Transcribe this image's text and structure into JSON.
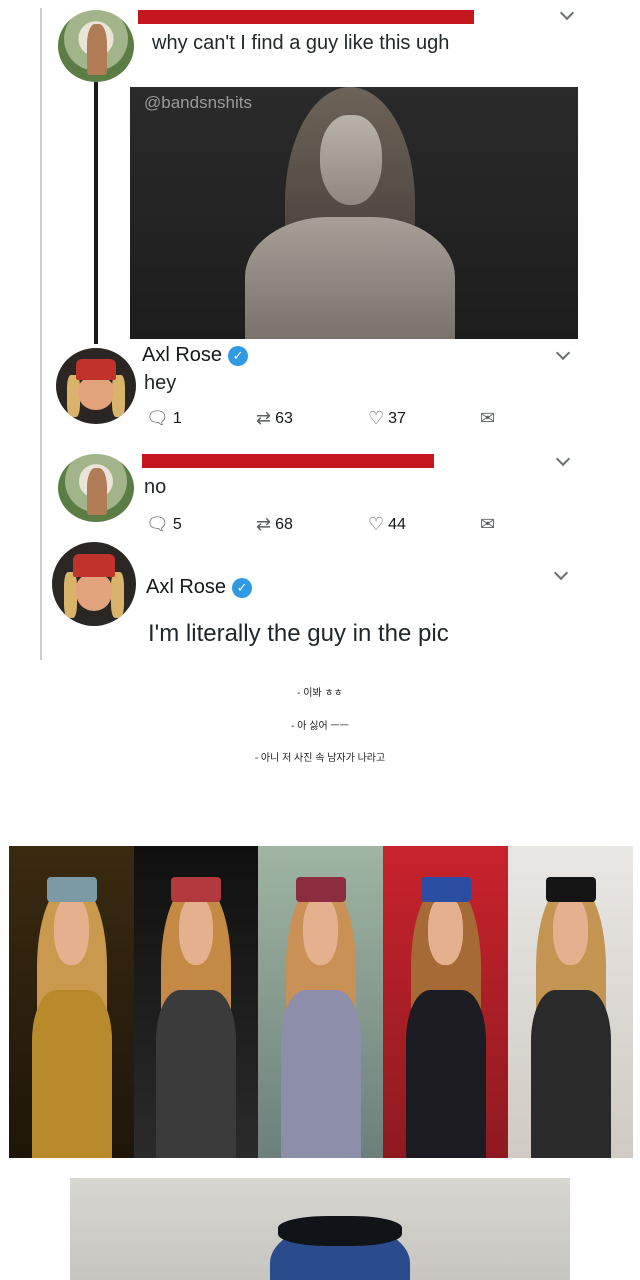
{
  "tweets": {
    "first": {
      "text": "why can't I find a guy like this ugh",
      "image_watermark": "@bandsnshits"
    },
    "reply1": {
      "name": "Axl Rose",
      "text": "hey",
      "replies": "1",
      "retweets": "63",
      "likes": "37"
    },
    "reply2": {
      "text": "no",
      "replies": "5",
      "retweets": "68",
      "likes": "44"
    },
    "reply3": {
      "name": "Axl Rose",
      "text": "I'm literally the guy in the pic"
    }
  },
  "captions": [
    "- 이봐 ㅎㅎ",
    "- 아 싫어 ㅡㅡ",
    "- 아니 저 사진 속 남자가 나라고"
  ],
  "icons": {
    "reply": "reply-icon",
    "retweet": "retweet-icon",
    "like": "heart-icon",
    "dm": "envelope-icon",
    "verified": "verified-badge-icon",
    "more": "chevron-down-icon"
  },
  "colors": {
    "verified": "#2f9ae2",
    "redaction": "#c4161c",
    "muted": "#657786"
  }
}
